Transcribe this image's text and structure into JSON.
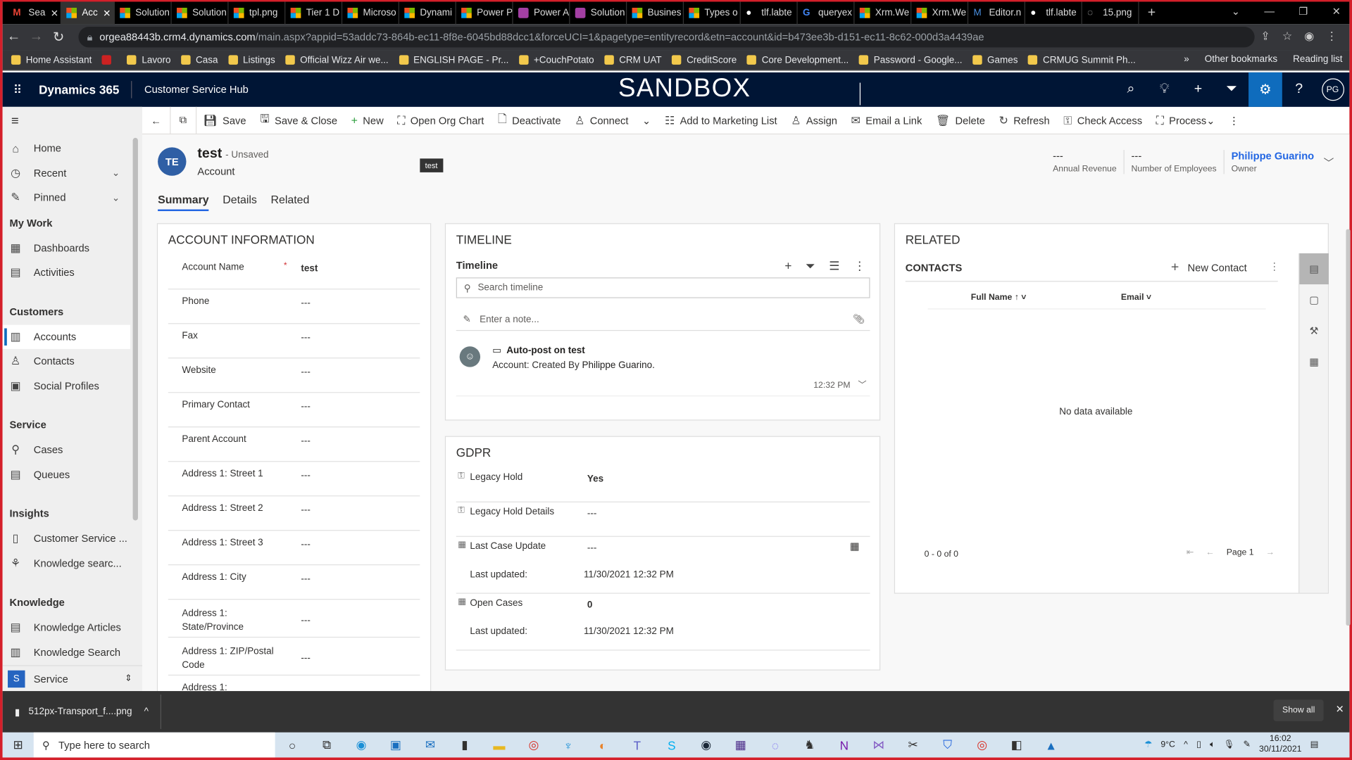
{
  "browser": {
    "tabs": [
      {
        "label": "Sea",
        "icon": "gmail",
        "active": false
      },
      {
        "label": "Acc",
        "icon": "microsoft",
        "active": true
      },
      {
        "label": "Solution",
        "icon": "microsoft"
      },
      {
        "label": "Solution",
        "icon": "microsoft"
      },
      {
        "label": "tpl.png",
        "icon": "microsoft"
      },
      {
        "label": "Tier 1 D",
        "icon": "microsoft"
      },
      {
        "label": "Microso",
        "icon": "microsoft"
      },
      {
        "label": "Dynami",
        "icon": "microsoft"
      },
      {
        "label": "Power P",
        "icon": "microsoft"
      },
      {
        "label": "Power A",
        "icon": "power-apps"
      },
      {
        "label": "Solution",
        "icon": "power-apps"
      },
      {
        "label": "Busines",
        "icon": "microsoft"
      },
      {
        "label": "Types o",
        "icon": "microsoft"
      },
      {
        "label": "tlf.labte",
        "icon": "github"
      },
      {
        "label": "queryex",
        "icon": "google"
      },
      {
        "label": "Xrm.We",
        "icon": "microsoft"
      },
      {
        "label": "Xrm.We",
        "icon": "microsoft"
      },
      {
        "label": "Editor.n",
        "icon": "markdown"
      },
      {
        "label": "tlf.labte",
        "icon": "github"
      },
      {
        "label": "15.png",
        "icon": "globe"
      }
    ],
    "url_host": "orgea88443b.crm4.dynamics.com",
    "url_path": "/main.aspx?appid=53addc73-864b-ec11-8f8e-6045bd88dcc1&forceUCI=1&pagetype=entityrecord&etn=account&id=b473ee3b-d151-ec11-8c62-000d3a4439ae",
    "bookmarks": [
      "Home Assistant",
      "",
      "Lavoro",
      "Casa",
      "Listings",
      "Official Wizz Air we...",
      "ENGLISH PAGE - Pr...",
      "+CouchPotato",
      "CRM UAT",
      "CreditScore",
      "Core Development...",
      "Password - Google...",
      "Games",
      "CRMUG Summit Ph..."
    ],
    "bookmarks_right": [
      "»",
      "Other bookmarks",
      "Reading list"
    ]
  },
  "app": {
    "brand": "Dynamics 365",
    "name": "Customer Service Hub",
    "env_banner": "SANDBOX",
    "user_initials": "PG",
    "accent": "#0f6cbd"
  },
  "sidebar": {
    "items": [
      {
        "label": "Home",
        "icon": "⌂"
      },
      {
        "label": "Recent",
        "icon": "◷",
        "expandable": true
      },
      {
        "label": "Pinned",
        "icon": "✎",
        "expandable": true
      }
    ],
    "groups": [
      {
        "title": "My Work",
        "items": [
          {
            "label": "Dashboards",
            "icon": "▦"
          },
          {
            "label": "Activities",
            "icon": "▤"
          }
        ]
      },
      {
        "title": "Customers",
        "items": [
          {
            "label": "Accounts",
            "icon": "▥",
            "selected": true
          },
          {
            "label": "Contacts",
            "icon": "♙"
          },
          {
            "label": "Social Profiles",
            "icon": "▣"
          }
        ]
      },
      {
        "title": "Service",
        "items": [
          {
            "label": "Cases",
            "icon": "⚲"
          },
          {
            "label": "Queues",
            "icon": "▤"
          }
        ]
      },
      {
        "title": "Insights",
        "items": [
          {
            "label": "Customer Service ...",
            "icon": "▯"
          },
          {
            "label": "Knowledge searc...",
            "icon": "⚘"
          }
        ]
      },
      {
        "title": "Knowledge",
        "items": [
          {
            "label": "Knowledge Articles",
            "icon": "▤"
          },
          {
            "label": "Knowledge Search",
            "icon": "▥"
          }
        ]
      }
    ],
    "area": {
      "letter": "S",
      "label": "Service"
    }
  },
  "commands": [
    "Save",
    "Save & Close",
    "New",
    "Open Org Chart",
    "Deactivate",
    "Connect",
    "Add to Marketing List",
    "Assign",
    "Email a Link",
    "Delete",
    "Refresh",
    "Check Access",
    "Process"
  ],
  "record": {
    "initials": "TE",
    "title": "test",
    "status": "- Unsaved",
    "entity": "Account",
    "tooltip": "test",
    "header_fields": [
      {
        "value": "---",
        "label": "Annual Revenue"
      },
      {
        "value": "---",
        "label": "Number of Employees"
      },
      {
        "value": "Philippe Guarino",
        "label": "Owner"
      }
    ],
    "tabs": [
      "Summary",
      "Details",
      "Related"
    ]
  },
  "account_info": {
    "title": "ACCOUNT INFORMATION",
    "fields": [
      {
        "label": "Account Name",
        "value": "test",
        "required": true
      },
      {
        "label": "Phone",
        "value": "---"
      },
      {
        "label": "Fax",
        "value": "---"
      },
      {
        "label": "Website",
        "value": "---"
      },
      {
        "label": "Primary Contact",
        "value": "---"
      },
      {
        "label": "Parent Account",
        "value": "---"
      },
      {
        "label": "Address 1: Street 1",
        "value": "---"
      },
      {
        "label": "Address 1: Street 2",
        "value": "---"
      },
      {
        "label": "Address 1: Street 3",
        "value": "---"
      },
      {
        "label": "Address 1: City",
        "value": "---"
      },
      {
        "label": "Address 1: State/Province",
        "value": "---"
      },
      {
        "label": "Address 1: ZIP/Postal Code",
        "value": "---"
      },
      {
        "label": "Address 1:",
        "value": ""
      }
    ]
  },
  "timeline": {
    "section_title": "TIMELINE",
    "title": "Timeline",
    "search_placeholder": "Search timeline",
    "note_placeholder": "Enter a note...",
    "item": {
      "title": "Auto-post on test",
      "desc_prefix": "Account: Created By",
      "desc_author": "Philippe Guarino.",
      "time": "12:32 PM"
    }
  },
  "gdpr": {
    "title": "GDPR",
    "fields": [
      {
        "label": "Legacy Hold",
        "value": "Yes"
      },
      {
        "label": "Legacy Hold Details",
        "value": "---"
      },
      {
        "label": "Last Case Update",
        "value": "---",
        "sub_label": "Last updated:",
        "sub_value": "11/30/2021 12:32 PM"
      },
      {
        "label": "Open Cases",
        "value": "0",
        "sub_label": "Last updated:",
        "sub_value": "11/30/2021 12:32 PM"
      }
    ]
  },
  "related": {
    "title": "RELATED",
    "subgrid_title": "CONTACTS",
    "new_label": "New Contact",
    "columns": [
      "Full Name",
      "Email"
    ],
    "empty": "No data available",
    "count": "0 - 0 of 0",
    "page": "Page 1"
  },
  "downloads": {
    "file": "512px-Transport_f....png",
    "show_all": "Show all"
  },
  "taskbar": {
    "search_placeholder": "Type here to search",
    "weather": "9°C",
    "time": "16:02",
    "date": "30/11/2021"
  }
}
